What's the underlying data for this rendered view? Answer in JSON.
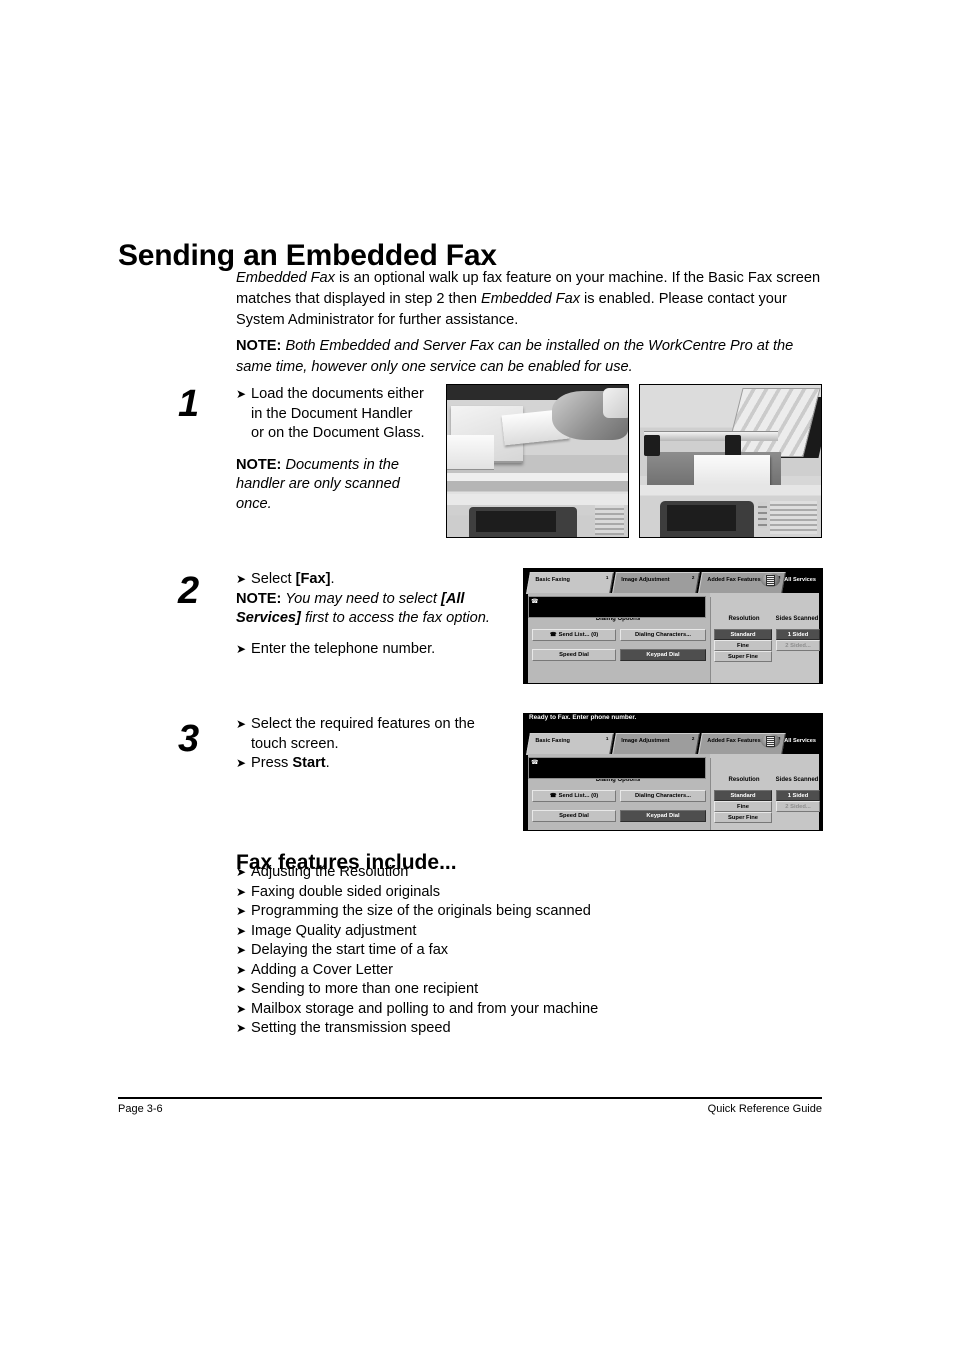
{
  "page": {
    "title": "Sending an Embedded Fax",
    "intro": {
      "line1_part1": "Embedded Fax",
      "line1_part2": " is an optional walk up fax feature on your machine. If the Basic Fax screen matches that displayed in step 2 then ",
      "line1_part3": "Embedded Fax",
      "line1_part4": " is enabled. Please contact your System Administrator for further assistance.",
      "note_label": "NOTE:",
      "note_text": " Both Embedded and Server Fax can be installed on the WorkCentre Pro at the same time, however only one service can be enabled for use."
    },
    "steps": [
      {
        "number": "1",
        "bullets": [
          "Load the documents either in the Document Handler or on the Document Glass."
        ],
        "note_label": "NOTE:",
        "note_text": " Documents in the handler are only scanned once."
      },
      {
        "number": "2",
        "bullet1_prefix": "Select ",
        "bullet1_bold": "[Fax]",
        "bullet1_suffix": ".",
        "note_label": "NOTE:",
        "note_part1": " You may need to select ",
        "note_bold": "[All Services]",
        "note_part2": " first to access the fax option.",
        "bullet2": "Enter the telephone number."
      },
      {
        "number": "3",
        "bullet1": "Select the required features on the touch screen.",
        "bullet2_prefix": "Press ",
        "bullet2_bold": "Start",
        "bullet2_suffix": "."
      }
    ],
    "photos": [
      {
        "caption": "document-handler-loading-photo"
      },
      {
        "caption": "document-glass-loading-photo"
      }
    ],
    "fax_ui": {
      "status": "Ready to Fax. Enter phone number.",
      "tabs": [
        {
          "label": "Basic Faxing",
          "num": "1",
          "active": true
        },
        {
          "label": "Image Adjustment",
          "num": "2",
          "active": false
        },
        {
          "label": "Added Fax Features",
          "num": "3",
          "active": false
        }
      ],
      "all_services": "All Services",
      "groups": {
        "dialing_options": "Dialing Options",
        "resolution": "Resolution",
        "sides_scanned": "Sides Scanned"
      },
      "buttons": {
        "send_list": "Send List... (0)",
        "dialing_characters": "Dialing Characters...",
        "speed_dial": "Speed Dial",
        "keypad_dial": "Keypad Dial",
        "standard": "Standard",
        "fine": "Fine",
        "super_fine": "Super Fine",
        "one_sided": "1 Sided",
        "two_sided": "2 Sided..."
      }
    },
    "features": {
      "heading": "Fax features include...",
      "items": [
        "Adjusting the Resolution",
        "Faxing double sided originals",
        "Programming the size of the originals being scanned",
        "Image Quality adjustment",
        "Delaying the start time of a fax",
        "Adding a Cover Letter",
        "Sending to more than one recipient",
        "Mailbox storage and polling to and from your machine",
        "Setting the transmission speed"
      ]
    },
    "footer": {
      "left": "Page 3-6",
      "right": "Quick Reference Guide"
    },
    "icons": {
      "bullet_arrow": "➤",
      "phone": "☎"
    }
  }
}
